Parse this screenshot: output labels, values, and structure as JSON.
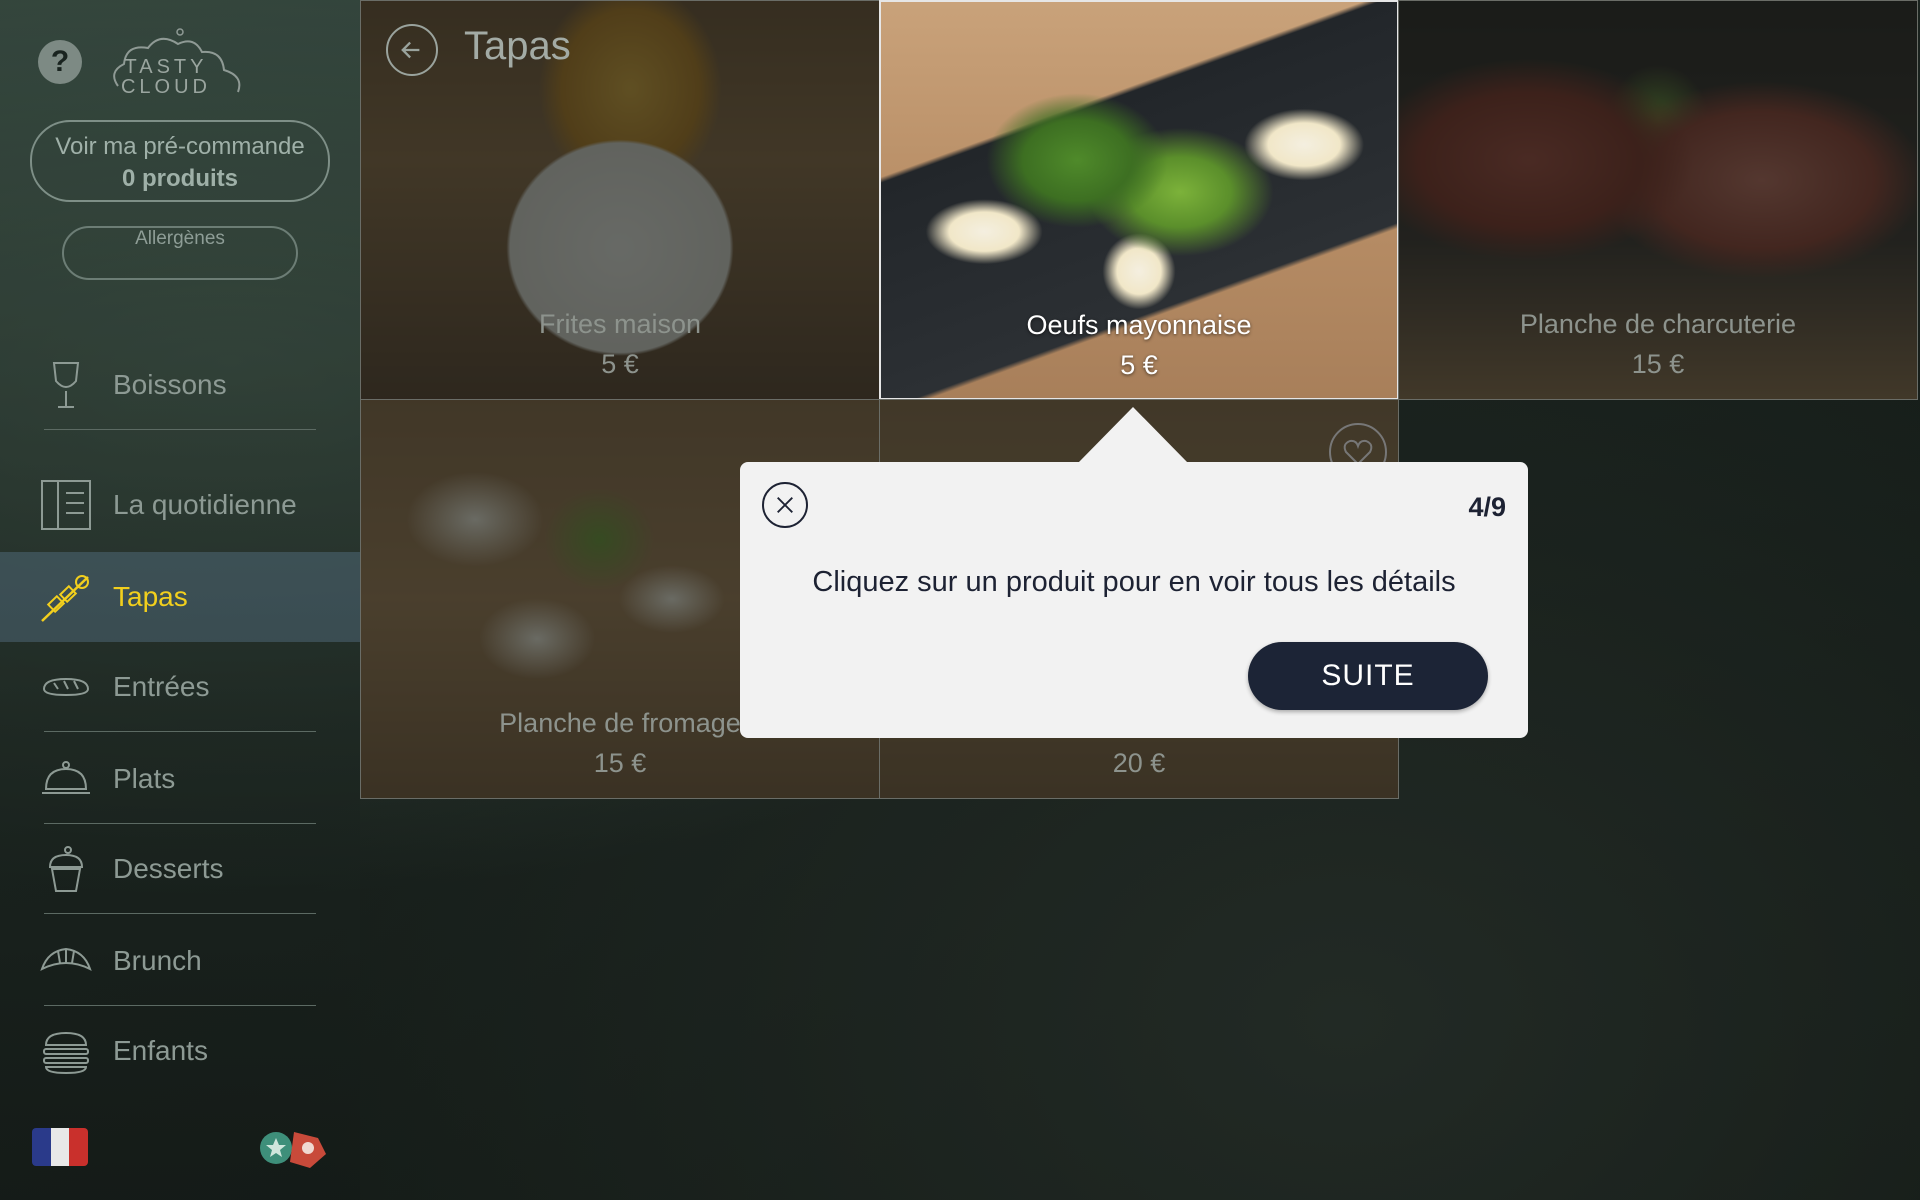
{
  "sidebar": {
    "help_glyph": "?",
    "logo_line1": "TASTY",
    "logo_line2": "CLOUD",
    "precommande_label": "Voir ma pré-commande",
    "precommande_count": "0 produits",
    "allergenes_label": "Allergènes",
    "items": [
      {
        "label": "Boissons",
        "icon": "wine-glass-icon",
        "active": false
      },
      {
        "label": "La quotidienne",
        "icon": "menu-book-icon",
        "active": false
      },
      {
        "label": "Tapas",
        "icon": "skewer-icon",
        "active": true
      },
      {
        "label": "Entrées",
        "icon": "bread-icon",
        "active": false
      },
      {
        "label": "Plats",
        "icon": "cloche-icon",
        "active": false
      },
      {
        "label": "Desserts",
        "icon": "cupcake-icon",
        "active": false
      },
      {
        "label": "Brunch",
        "icon": "croissant-icon",
        "active": false
      },
      {
        "label": "Enfants",
        "icon": "burger-icon",
        "active": false
      }
    ],
    "language_flag": "french-flag-icon",
    "active_color": "#f2cf1d"
  },
  "main": {
    "title": "Tapas",
    "products": [
      {
        "name": "Frites maison",
        "price": "5 €",
        "highlighted": false
      },
      {
        "name": "Oeufs mayonnaise",
        "price": "5 €",
        "highlighted": true
      },
      {
        "name": "Planche de charcuterie",
        "price": "15 €",
        "highlighted": false
      },
      {
        "name": "Planche de fromage",
        "price": "15 €",
        "highlighted": false
      },
      {
        "name": "",
        "price": "20 €",
        "highlighted": false
      }
    ]
  },
  "tour": {
    "step": "4/9",
    "message": "Cliquez sur un produit pour en voir tous les détails",
    "next_label": "SUITE"
  },
  "colors": {
    "accent": "#f2cf1d",
    "dialog_bg": "#f2f2f2",
    "button_bg": "#1c2436"
  }
}
